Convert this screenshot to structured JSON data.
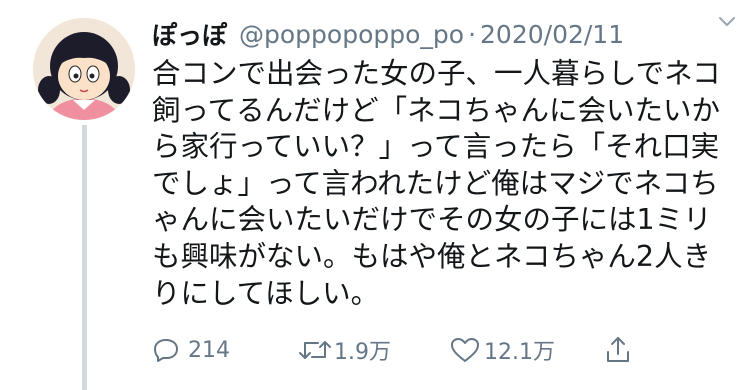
{
  "tweet": {
    "display_name": "ぽっぽ",
    "handle": "@poppopoppo_po",
    "separator": "·",
    "date": "2020/02/11",
    "text": "合コンで出会った女の子、一人暮らしでネコ\n飼ってるんだけど「ネコちゃんに会いたいか\nら家行っていい？」って言ったら「それ口実\nでしょ」って言われたけど俺はマジでネコち\nゃんに会いたいだけでその女の子には1ミリ\nも興味がない。もはや俺とネコちゃん2人き\nりにしてほしい。"
  },
  "actions": {
    "reply": {
      "icon": "reply-icon",
      "count": "214"
    },
    "retweet": {
      "icon": "retweet-icon",
      "count": "1.9万"
    },
    "like": {
      "icon": "heart-icon",
      "count": "12.1万"
    },
    "share": {
      "icon": "share-icon"
    }
  },
  "colors": {
    "text": "#14171a",
    "secondary": "#657786",
    "thread_line": "#cfd9de",
    "background": "#ffffff"
  }
}
